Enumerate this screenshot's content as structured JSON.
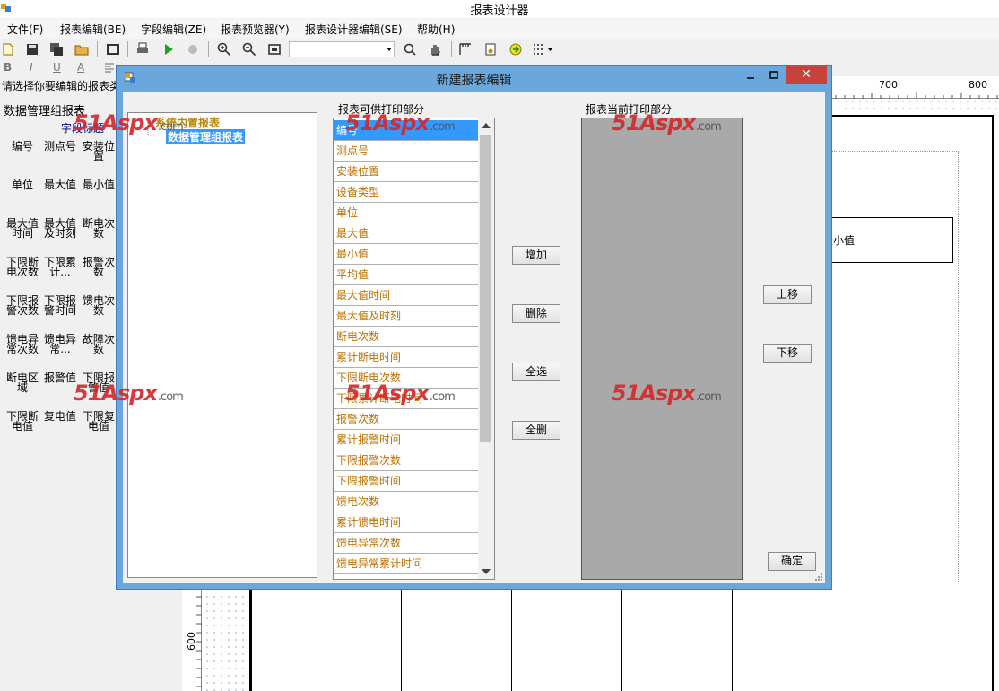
{
  "app": {
    "title": "报表设计器"
  },
  "menu": [
    "文件(F)",
    "报表编辑(BE)",
    "字段编辑(ZE)",
    "报表预览器(Y)",
    "报表设计器编辑(SE)",
    "帮助(H)"
  ],
  "toolbar": {
    "format_buttons": [
      "B",
      "I",
      "U",
      "A"
    ]
  },
  "hint": "请选择你要编辑的报表类",
  "left_panel": {
    "title": "数据管理组报表",
    "subtitle": "字段标题",
    "fields": [
      [
        "编号",
        "测点号",
        "安装位置"
      ],
      [
        "单位",
        "最大值",
        "最小值"
      ],
      [
        "最大值时间",
        "最大值及时刻",
        "断电次数"
      ],
      [
        "下限断电次数",
        "下限累计...",
        "报警次数"
      ],
      [
        "下限报警次数",
        "下限报警时间",
        "馈电次数"
      ],
      [
        "馈电异常次数",
        "馈电异常...",
        "故障次数"
      ],
      [
        "断电区域",
        "报警值",
        "下限报警值"
      ],
      [
        "下限断电值",
        "复电值",
        "下限复电值"
      ]
    ]
  },
  "ruler": {
    "h": [
      "700",
      "800"
    ],
    "v": "600"
  },
  "canvas": {
    "header_cell": "最小值"
  },
  "watermark": {
    "brand": "51Aspx",
    "suffix": ".com"
  },
  "dialog": {
    "title": "新建报表编辑",
    "tree": {
      "root": "系统内置报表",
      "child": "数据管理组报表"
    },
    "available_label": "报表可供打印部分",
    "current_label": "报表当前打印部分",
    "available_items": [
      "编号",
      "测点号",
      "安装位置",
      "设备类型",
      "单位",
      "最大值",
      "最小值",
      "平均值",
      "最大值时间",
      "最大值及时刻",
      "断电次数",
      "累计断电时间",
      "下限断电次数",
      "下限累计断电时间",
      "报警次数",
      "累计报警时间",
      "下限报警次数",
      "下限报警时间",
      "馈电次数",
      "累计馈电时间",
      "馈电异常次数",
      "馈电异常累计时间"
    ],
    "buttons": {
      "add": "增加",
      "delete": "删除",
      "select_all": "全选",
      "delete_all": "全删",
      "move_up": "上移",
      "move_down": "下移",
      "ok": "确定",
      "close": "✕"
    }
  }
}
